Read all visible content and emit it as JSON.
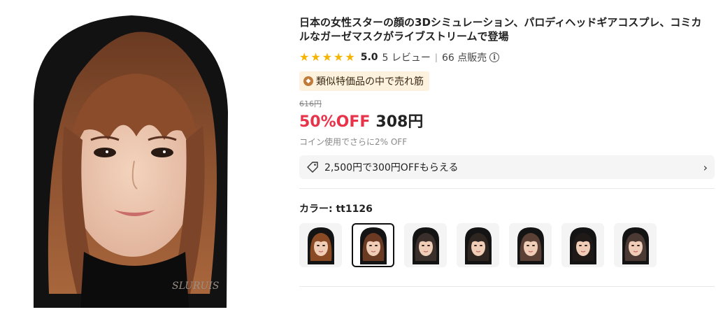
{
  "product": {
    "title": "日本の女性スターの顔の3Dシミュレーション、パロディヘッドギアコスプレ、コミカルなガーゼマスクがライブストリームで登場",
    "image_watermark": "SLURUIS"
  },
  "rating": {
    "stars": 5,
    "score": "5.0",
    "reviews": "5 レビュー",
    "separator": "|",
    "sold": "66 点販売",
    "info_icon": "i"
  },
  "badge": {
    "label": "類似特価品の中で売れ筋",
    "color": "#fdf2dd"
  },
  "pricing": {
    "original": "616円",
    "discount": "50%OFF",
    "price": "308円",
    "coin_note": "コイン使用でさらに2% OFF",
    "accent_color": "#e8344b"
  },
  "coupon": {
    "text": "2,500円で300円OFFもらえる",
    "icon": "tag-icon",
    "chevron": "›"
  },
  "color_option": {
    "label": "カラー: ",
    "selected": "tt1126"
  },
  "swatches": [
    {
      "hair": "#8a4a24"
    },
    {
      "hair": "#6b3a22",
      "selected": true
    },
    {
      "hair": "#3b2f2c"
    },
    {
      "hair": "#2f2520"
    },
    {
      "hair": "#5a4035"
    },
    {
      "hair": "#1f1a18"
    },
    {
      "hair": "#4a3a33"
    }
  ]
}
